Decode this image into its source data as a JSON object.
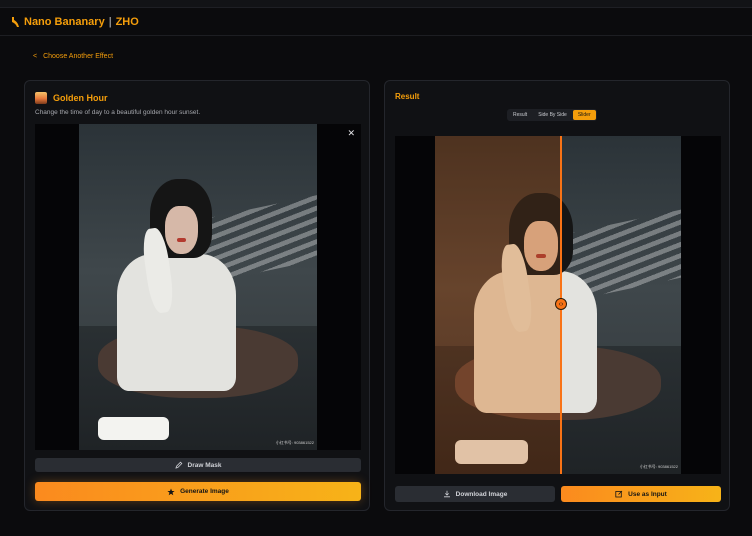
{
  "app": {
    "title_part1": "Nano Bananary",
    "separator": "|",
    "title_part2": "ZHO"
  },
  "nav": {
    "back_arrow": "<",
    "back_label": "Choose Another Effect"
  },
  "effect": {
    "name": "Golden Hour",
    "description": "Change the time of day to a beautiful golden hour sunset.",
    "close_symbol": "✕",
    "watermark": "小红书号: 903861522"
  },
  "left_actions": {
    "draw_mask": "Draw Mask",
    "generate": "Generate Image"
  },
  "result": {
    "title": "Result",
    "view_options": [
      "Result",
      "Side By Side",
      "Slider"
    ],
    "active_view": "Slider",
    "slider_position_percent": 51,
    "watermark": "小红书号: 903861522"
  },
  "right_actions": {
    "download": "Download Image",
    "use_as_input": "Use as Input"
  },
  "colors": {
    "accent": "#f59e0b",
    "accent_gradient_start": "#fb8a1e",
    "accent_gradient_end": "#f7b318",
    "background": "#0b0b0d",
    "panel": "#101114",
    "divider": "#f97316"
  },
  "icons": {
    "brand": "banana-icon",
    "effect_thumb": "sunset-thumbnail-icon",
    "close": "close-icon",
    "draw_mask": "pencil-icon",
    "generate": "star-icon",
    "download": "download-icon",
    "use_as_input": "edit-square-icon",
    "slider_handle": "drag-handle-icon"
  }
}
